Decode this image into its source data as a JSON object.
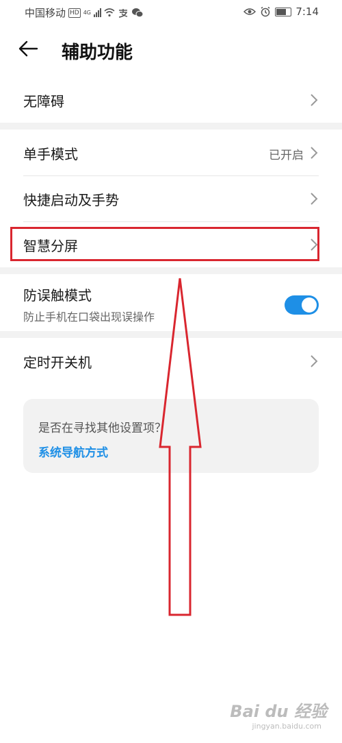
{
  "status_bar": {
    "carrier": "中国移动",
    "network_type": "4G",
    "time": "7:14"
  },
  "header": {
    "back_icon": "arrow-left-icon",
    "title": "辅助功能"
  },
  "settings": {
    "accessibility": {
      "label": "无障碍"
    },
    "one_hand_mode": {
      "label": "单手模式",
      "value": "已开启"
    },
    "shortcuts_gestures": {
      "label": "快捷启动及手势"
    },
    "smart_split_screen": {
      "label": "智慧分屏"
    },
    "pocket_mode": {
      "label": "防误触模式",
      "description": "防止手机在口袋出现误操作",
      "enabled": true
    },
    "scheduled_power": {
      "label": "定时开关机"
    }
  },
  "suggestion": {
    "question": "是否在寻找其他设置项？",
    "link": "系统导航方式"
  },
  "colors": {
    "accent": "#1e8fe6",
    "annotation_red": "#d9262f"
  },
  "watermark": {
    "main": "Bai du 经验",
    "sub": "jingyan.baidu.com"
  }
}
